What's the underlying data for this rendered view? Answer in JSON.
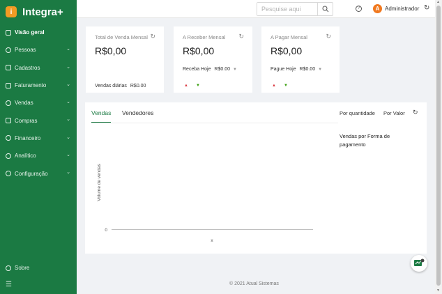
{
  "brand": {
    "name": "Integra+",
    "logo_icon": "integra-logo-icon",
    "logo_glyph": "i"
  },
  "sidebar": {
    "items": [
      {
        "label": "Visão geral",
        "icon": "home-icon",
        "active": true,
        "expandable": false
      },
      {
        "label": "Pessoas",
        "icon": "people-icon",
        "expandable": true
      },
      {
        "label": "Cadastros",
        "icon": "list-icon",
        "expandable": true
      },
      {
        "label": "Faturamento",
        "icon": "invoice-icon",
        "expandable": true
      },
      {
        "label": "Vendas",
        "icon": "sales-icon",
        "expandable": true
      },
      {
        "label": "Compras",
        "icon": "cart-icon",
        "expandable": true
      },
      {
        "label": "Financeiro",
        "icon": "money-icon",
        "expandable": true
      },
      {
        "label": "Analítico",
        "icon": "analytics-icon",
        "expandable": true
      },
      {
        "label": "Configuração",
        "icon": "gear-icon",
        "expandable": true
      }
    ],
    "bottom_item": {
      "label": "Sobre",
      "icon": "info-icon"
    },
    "collapse_icon": "menu-collapse-icon"
  },
  "topbar": {
    "search_placeholder": "Pesquise aqui",
    "user_initial": "A",
    "user_name": "Administrador"
  },
  "cards": [
    {
      "title": "Total de Venda Mensal",
      "value": "R$0,00",
      "sub_label": "Vendas diárias",
      "sub_value": "R$0.00",
      "has_dropdown": false
    },
    {
      "title": "A Receber Mensal",
      "value": "R$0,00",
      "sub_label": "Receba Hoje",
      "sub_value": "R$0.00",
      "has_dropdown": true
    },
    {
      "title": "A Pagar Mensal",
      "value": "R$0,00",
      "sub_label": "Pague Hoje",
      "sub_value": "R$0.00",
      "has_dropdown": true
    }
  ],
  "chart_panel": {
    "tabs": [
      "Vendas",
      "Vendedores"
    ],
    "active_tab": 0,
    "options": [
      "Por quantidade",
      "Por Valor"
    ],
    "side_title": "Vendas por Forma de pagamento"
  },
  "chart_data": {
    "type": "bar",
    "categories": [],
    "values": [],
    "title": "",
    "xlabel": "x",
    "ylabel": "Volume de vendas",
    "y_ticks": [
      "0"
    ]
  },
  "footer": {
    "text": "© 2021 Atual Sistemas"
  },
  "colors": {
    "sidebar": "#1b7a43",
    "accent": "#1b7a43",
    "avatar": "#f0781e",
    "logo": "#f29b24",
    "up": "#d9363e",
    "down": "#389e0d"
  }
}
